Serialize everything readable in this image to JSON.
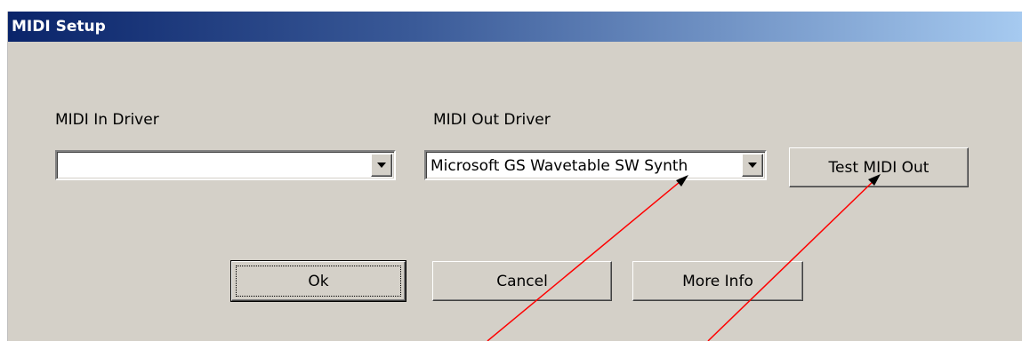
{
  "window": {
    "title": "MIDI Setup"
  },
  "midi_in": {
    "label": "MIDI In Driver",
    "value": ""
  },
  "midi_out": {
    "label": "MIDI Out Driver",
    "value": "Microsoft GS Wavetable SW Synth"
  },
  "buttons": {
    "test_midi_out": "Test MIDI Out",
    "ok": "Ok",
    "cancel": "Cancel",
    "more_info": "More Info"
  },
  "colors": {
    "dialog_face": "#d4d0c8",
    "titlebar_start": "#0a246a",
    "titlebar_end": "#a6caf0",
    "annotation_arrow": "#ff0000"
  }
}
